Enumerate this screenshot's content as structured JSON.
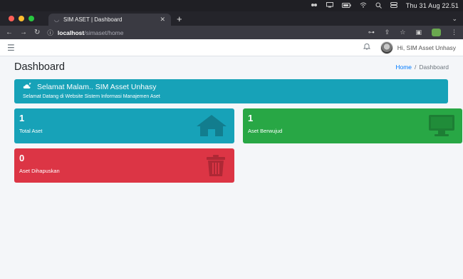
{
  "os_menubar": {
    "clock": "Thu 31 Aug  22.51"
  },
  "browser": {
    "tab_title": "SIM ASET | Dashboard",
    "url_host": "localhost",
    "url_path": "/simaset/home"
  },
  "navbar": {
    "notification_count": "",
    "greeting": "Hi, SIM Asset Unhasy"
  },
  "page": {
    "title": "Dashboard",
    "breadcrumb": {
      "home": "Home",
      "separator": "/",
      "current": "Dashboard"
    }
  },
  "welcome": {
    "title": "Selamat Malam.. SIM Asset Unhasy",
    "subtitle": "Selamat Datang di Website Sistem Informasi Manajemen Aset"
  },
  "stats": [
    {
      "value": "1",
      "label": "Total Aset",
      "color": "#17a2b8",
      "icon": "home-icon"
    },
    {
      "value": "1",
      "label": "Aset Berwujud",
      "color": "#28a745",
      "icon": "desktop-icon"
    },
    {
      "value": "0",
      "label": "Aset Dihapuskan",
      "color": "#dc3545",
      "icon": "trash-icon"
    }
  ],
  "colors": {
    "info": "#17a2b8",
    "success": "#28a745",
    "danger": "#dc3545",
    "link": "#007bff"
  }
}
